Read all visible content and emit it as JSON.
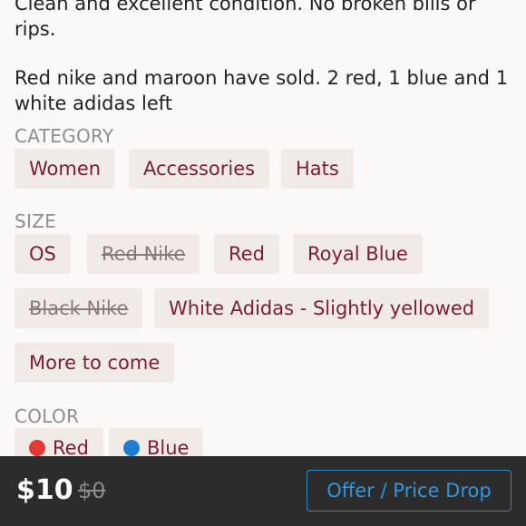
{
  "description": {
    "line1": "Clean and excellent condition. No broken bills or rips.",
    "line2": "Red nike and maroon have sold. 2 red, 1 blue and 1 white adidas left"
  },
  "category": {
    "title": "CATEGORY",
    "tags": [
      "Women",
      "Accessories",
      "Hats"
    ]
  },
  "size": {
    "title": "SIZE",
    "tags": [
      {
        "label": "OS",
        "sold_out": false
      },
      {
        "label": "Red Nike",
        "sold_out": true
      },
      {
        "label": "Red",
        "sold_out": false
      },
      {
        "label": "Royal Blue",
        "sold_out": false
      },
      {
        "label": "Black Nike",
        "sold_out": true
      },
      {
        "label": "White Adidas - Slightly yellowed",
        "sold_out": false
      },
      {
        "label": "More to come",
        "sold_out": false
      }
    ]
  },
  "color": {
    "title": "COLOR",
    "tags": [
      {
        "label": "Red",
        "swatch": "#e53935"
      },
      {
        "label": "Blue",
        "swatch": "#1e7fd0"
      }
    ]
  },
  "footer": {
    "price": "$10",
    "original_price": "$0",
    "offer_label": "Offer / Price Drop"
  }
}
